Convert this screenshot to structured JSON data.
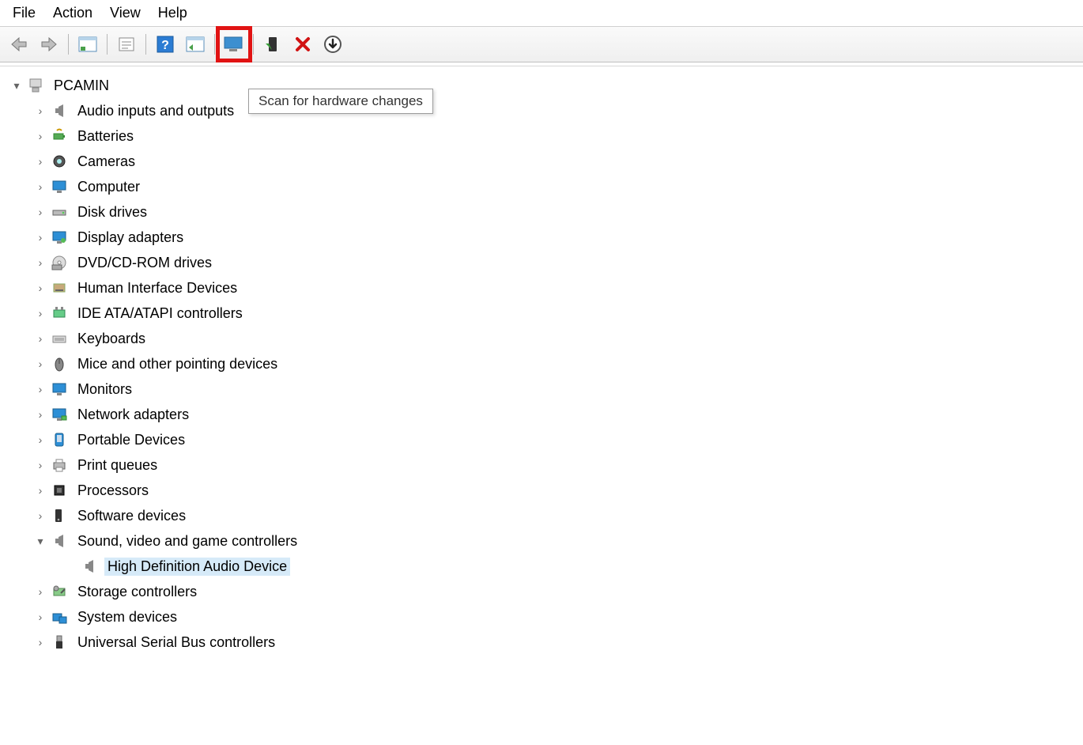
{
  "menu": {
    "file": "File",
    "action": "Action",
    "view": "View",
    "help": "Help"
  },
  "tooltip": "Scan for hardware changes",
  "root": "PCAMIN",
  "categories": [
    {
      "name": "Audio inputs and outputs",
      "icon": "speaker"
    },
    {
      "name": "Batteries",
      "icon": "battery"
    },
    {
      "name": "Cameras",
      "icon": "camera"
    },
    {
      "name": "Computer",
      "icon": "monitor"
    },
    {
      "name": "Disk drives",
      "icon": "disk"
    },
    {
      "name": "Display adapters",
      "icon": "display"
    },
    {
      "name": "DVD/CD-ROM drives",
      "icon": "dvd"
    },
    {
      "name": "Human Interface Devices",
      "icon": "hid"
    },
    {
      "name": "IDE ATA/ATAPI controllers",
      "icon": "ide"
    },
    {
      "name": "Keyboards",
      "icon": "keyboard"
    },
    {
      "name": "Mice and other pointing devices",
      "icon": "mouse"
    },
    {
      "name": "Monitors",
      "icon": "monitor"
    },
    {
      "name": "Network adapters",
      "icon": "network"
    },
    {
      "name": "Portable Devices",
      "icon": "portable"
    },
    {
      "name": "Print queues",
      "icon": "printer"
    },
    {
      "name": "Processors",
      "icon": "cpu"
    },
    {
      "name": "Software devices",
      "icon": "software"
    },
    {
      "name": "Sound, video and game controllers",
      "icon": "speaker",
      "expanded": true,
      "children": [
        {
          "name": "High Definition Audio Device",
          "icon": "speaker",
          "selected": true
        }
      ]
    },
    {
      "name": "Storage controllers",
      "icon": "storage"
    },
    {
      "name": "System devices",
      "icon": "system"
    },
    {
      "name": "Universal Serial Bus controllers",
      "icon": "usb"
    }
  ]
}
